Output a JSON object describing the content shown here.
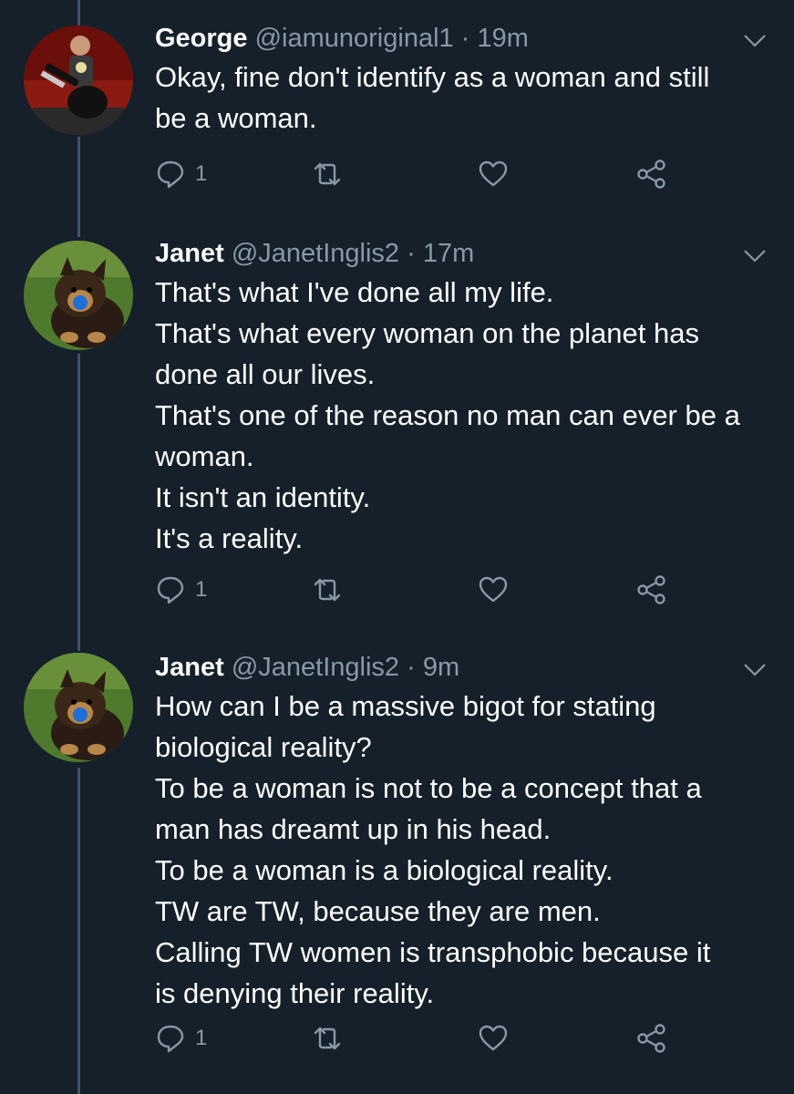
{
  "colors": {
    "background": "#15202b",
    "secondary_text": "#8899a6",
    "thread_line": "#3d5466"
  },
  "tweets": [
    {
      "name": "George",
      "handle": "@iamunoriginal1",
      "separator": "·",
      "time": "19m",
      "text": "Okay, fine don't identify as a woman and still\nbe a woman.",
      "reply_count": "1",
      "avatar": "person-with-guitar-avatar"
    },
    {
      "name": "Janet",
      "handle": "@JanetInglis2",
      "separator": "·",
      "time": "17m",
      "text": "That's what I've done all my life.\nThat's what every woman on the planet has\ndone all our lives.\nThat's one of the reason no man can ever be a\nwoman.\nIt isn't an identity.\nIt's a reality.",
      "reply_count": "1",
      "avatar": "dog-with-ball-avatar"
    },
    {
      "name": "Janet",
      "handle": "@JanetInglis2",
      "separator": "·",
      "time": "9m",
      "text": "How can I be a massive bigot for stating\nbiological reality?\nTo be a woman is not to be a concept that a\nman has dreamt up in his head.\nTo be a woman is a biological reality.\nTW are TW, because they are men.\nCalling TW women is transphobic because it\nis denying their reality.",
      "reply_count": "1",
      "avatar": "dog-with-ball-avatar"
    }
  ],
  "icons": [
    "reply-icon",
    "retweet-icon",
    "like-icon",
    "share-icon",
    "chevron-down-icon"
  ]
}
